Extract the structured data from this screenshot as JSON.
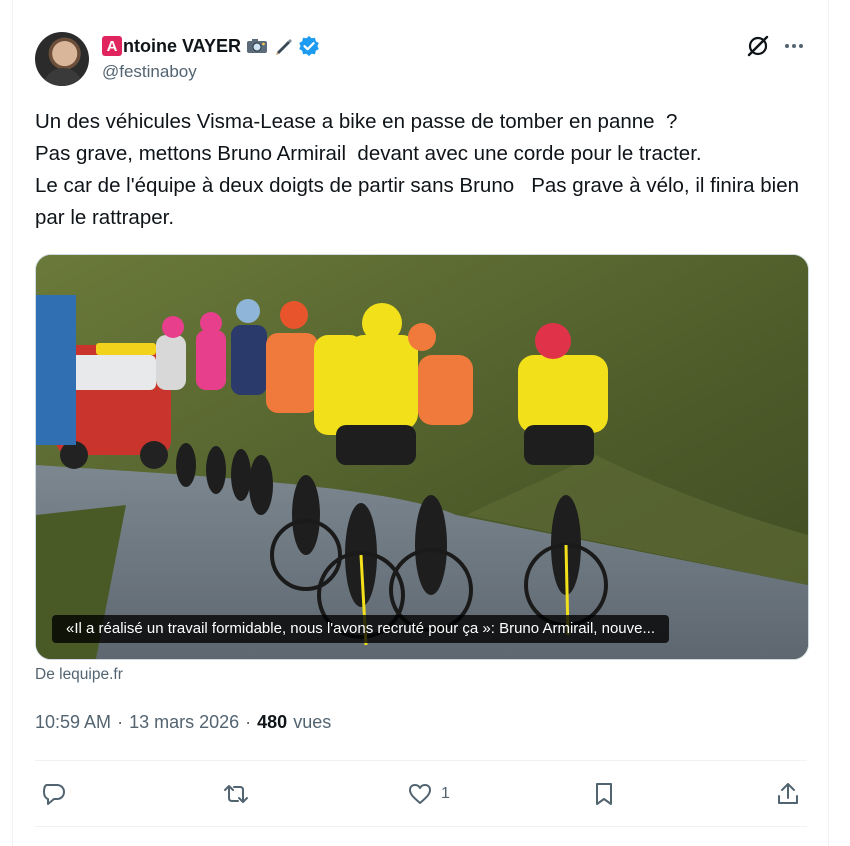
{
  "author": {
    "name_badge": "A",
    "display_name": "ntoine VAYER",
    "handle": "@festinaboy",
    "icons": [
      "camera-icon",
      "pen-icon",
      "verified-icon"
    ]
  },
  "header_icons": [
    "grok-icon",
    "more-icon"
  ],
  "tweet": {
    "text": "Un des véhicules Visma-Lease a bike en passe de tomber en panne  ?\nPas grave, mettons Bruno Armirail  devant avec une corde pour le tracter.\nLe car de l'équipe à deux doigts de partir sans Bruno   Pas grave à vélo, il finira bien  par le rattraper."
  },
  "media": {
    "caption": "«Il a réalisé un travail formidable, nous l'avons recruté pour ça »: Bruno Armirail, nouve...",
    "source": "De lequipe.fr"
  },
  "meta": {
    "time": "10:59 AM",
    "sep1": "·",
    "date": "13 mars 2026",
    "sep2": "·",
    "views_count": "480",
    "views_label": "vues"
  },
  "actions": {
    "reply_count": "",
    "retweet_count": "",
    "like_count": "1",
    "bookmark_count": ""
  },
  "colors": {
    "text": "#0f1419",
    "muted": "#536471",
    "verified": "#1d9bf0",
    "badge": "#e0245e",
    "border": "#eff3f4"
  }
}
